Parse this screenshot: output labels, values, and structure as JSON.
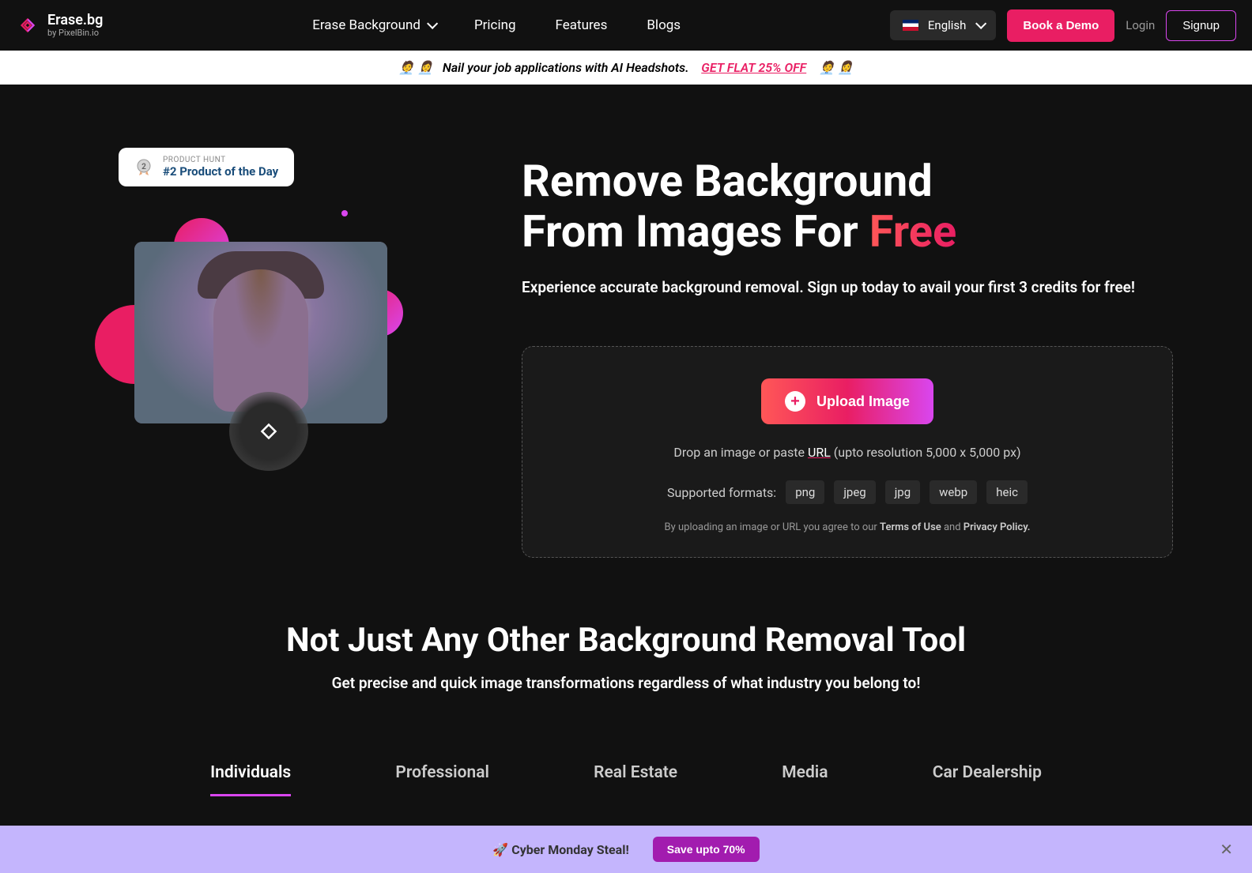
{
  "header": {
    "logo_title": "Erase.bg",
    "logo_sub": "by PixelBin.io",
    "nav": {
      "erase_bg": "Erase Background",
      "pricing": "Pricing",
      "features": "Features",
      "blogs": "Blogs"
    },
    "language": "English",
    "book_demo": "Book a Demo",
    "login": "Login",
    "signup": "Signup"
  },
  "promo": {
    "text": "Nail your job applications with AI Headshots.",
    "cta": "GET FLAT 25% OFF",
    "emoji_left": "🧑‍💼 👩‍💼",
    "emoji_right": "🧑‍💼 👩‍💼"
  },
  "product_hunt": {
    "label": "PRODUCT HUNT",
    "title": "#2 Product of the Day"
  },
  "hero": {
    "title_line1": "Remove Background",
    "title_line2_a": "From Images For ",
    "title_line2_b": "Free",
    "subtitle": "Experience accurate background removal. Sign up today to avail your first 3 credits for free!"
  },
  "upload": {
    "button": "Upload Image",
    "drop_prefix": "Drop an image or paste ",
    "drop_url": "URL",
    "drop_suffix": " (upto resolution 5,000 x 5,000 px)",
    "formats_label": "Supported formats:",
    "formats": [
      "png",
      "jpeg",
      "jpg",
      "webp",
      "heic"
    ],
    "terms_prefix": "By uploading an image or URL you agree to our ",
    "terms": "Terms of Use",
    "terms_and": " and ",
    "privacy": "Privacy Policy."
  },
  "section2": {
    "title": "Not Just Any Other Background Removal Tool",
    "subtitle": "Get precise and quick image transformations regardless of what industry you belong to!",
    "tabs": [
      "Individuals",
      "Professional",
      "Real Estate",
      "Media",
      "Car Dealership"
    ],
    "active_tab": 0
  },
  "bottom": {
    "emoji": "🚀",
    "text": "Cyber Monday Steal!",
    "cta": "Save upto 70%"
  }
}
